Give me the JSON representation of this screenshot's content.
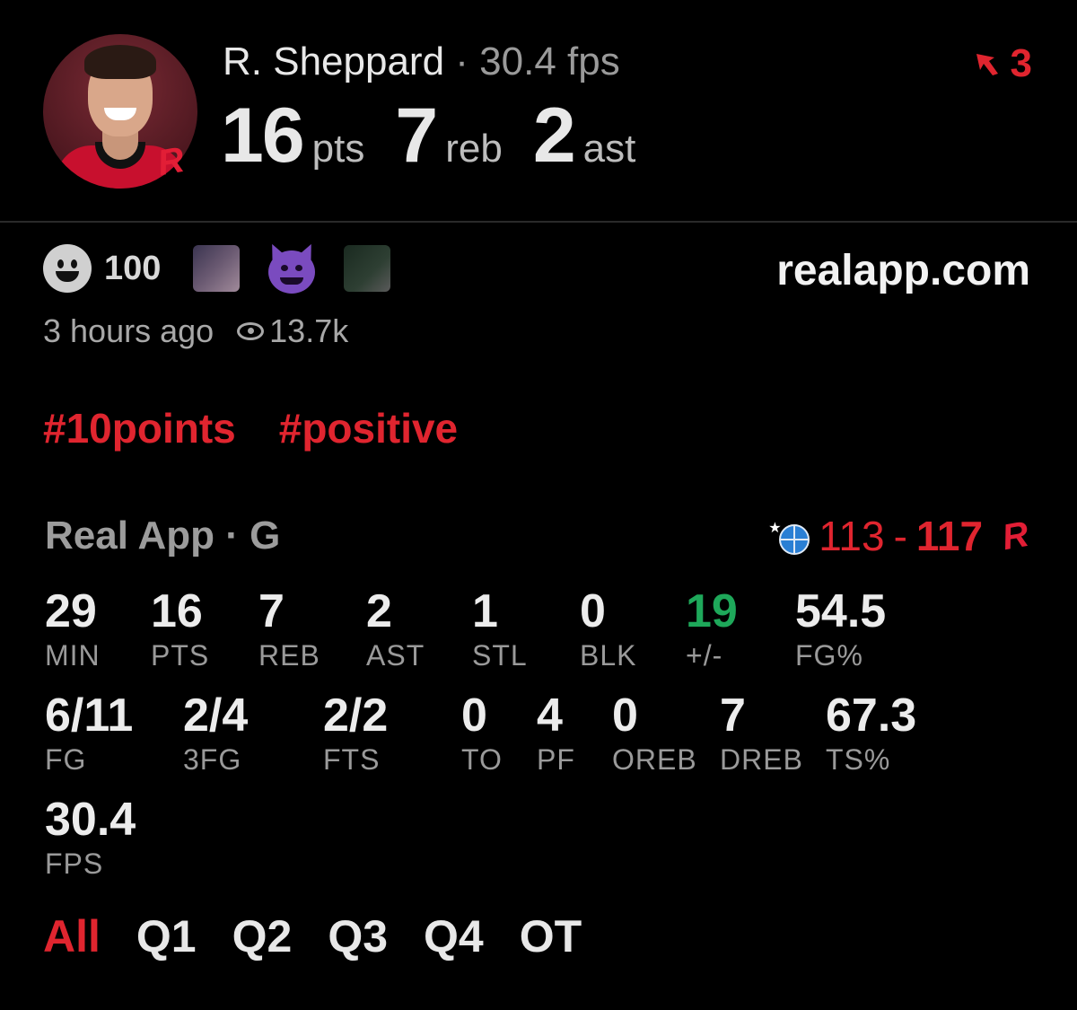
{
  "player": {
    "name": "R. Sheppard",
    "separator": " · ",
    "fps_text": "30.4 fps",
    "pts": "16",
    "pts_unit": "pts",
    "reb": "7",
    "reb_unit": "reb",
    "ast": "2",
    "ast_unit": "ast"
  },
  "badge_count": "3",
  "reactions": {
    "count": "100"
  },
  "site": "realapp.com",
  "meta": {
    "time": "3 hours ago",
    "views": "13.7k"
  },
  "tags": [
    "#10points",
    "#positive"
  ],
  "game": {
    "source": "Real App · G",
    "score_left": "113",
    "score_sep": "-",
    "score_right": "117"
  },
  "stats_row1": [
    {
      "value": "29",
      "label": "MIN"
    },
    {
      "value": "16",
      "label": "PTS"
    },
    {
      "value": "7",
      "label": "REB"
    },
    {
      "value": "2",
      "label": "AST"
    },
    {
      "value": "1",
      "label": "STL"
    },
    {
      "value": "0",
      "label": "BLK"
    },
    {
      "value": "19",
      "label": "+/-"
    },
    {
      "value": "54.5",
      "label": "FG%"
    }
  ],
  "stats_row2": [
    {
      "value": "6/11",
      "label": "FG"
    },
    {
      "value": "2/4",
      "label": "3FG"
    },
    {
      "value": "2/2",
      "label": "FTS"
    },
    {
      "value": "0",
      "label": "TO"
    },
    {
      "value": "4",
      "label": "PF"
    },
    {
      "value": "0",
      "label": "OREB"
    },
    {
      "value": "7",
      "label": "DREB"
    },
    {
      "value": "67.3",
      "label": "TS%"
    }
  ],
  "stats_row3": [
    {
      "value": "30.4",
      "label": "FPS"
    }
  ],
  "tabs": [
    "All",
    "Q1",
    "Q2",
    "Q3",
    "Q4",
    "OT"
  ],
  "colors": {
    "accent": "#e0252f",
    "positive": "#1ea85a",
    "background": "#000000"
  }
}
